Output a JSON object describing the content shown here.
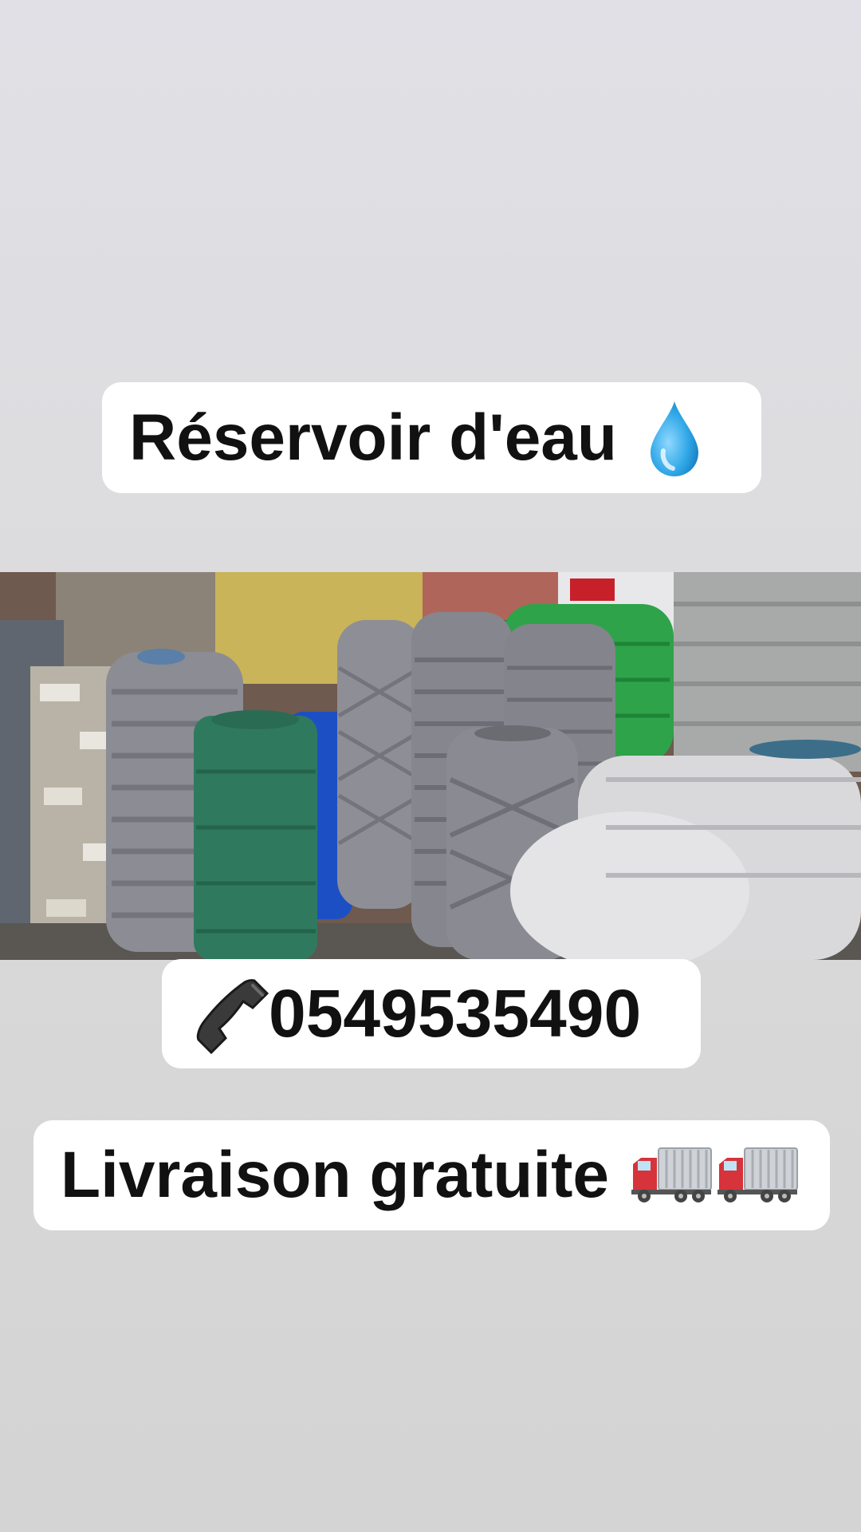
{
  "story": {
    "title": {
      "text": "Réservoir d'eau",
      "emoji_icon": "water-drop-icon"
    },
    "photo": {
      "subject_icon": "water-tanks-photo"
    },
    "contact": {
      "phone_icon": "telephone-receiver-icon",
      "phone_number": "0549535490"
    },
    "delivery": {
      "text": "Livraison gratuite",
      "emoji_icons": [
        "delivery-truck-icon",
        "delivery-truck-icon"
      ]
    }
  },
  "colors": {
    "pill_background": "#ffffff",
    "text": "#111111",
    "water_drop": "#2ea6e6",
    "tank_grey": "#8c8c94",
    "tank_green_dark": "#2f7a5e",
    "tank_green_bright": "#2ea34a",
    "tank_blue": "#1d4fc4",
    "truck_red": "#d6333b"
  }
}
